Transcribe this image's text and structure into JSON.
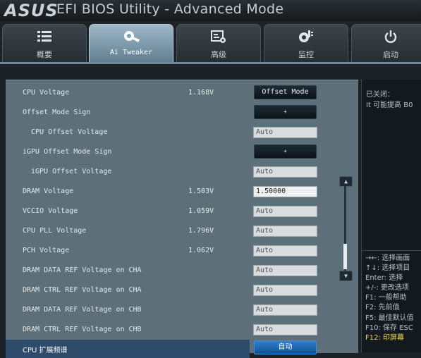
{
  "header": {
    "logo": "ASUS",
    "title": "EFI BIOS Utility - Advanced Mode"
  },
  "tabs": [
    {
      "label": "概要",
      "icon": "list-icon"
    },
    {
      "label": "Ai Tweaker",
      "icon": "ai-tweaker-icon",
      "active": true
    },
    {
      "label": "高级",
      "icon": "advanced-icon"
    },
    {
      "label": "监控",
      "icon": "monitor-icon"
    },
    {
      "label": "启动",
      "icon": "power-icon"
    }
  ],
  "rows": [
    {
      "label": "CPU Voltage",
      "value": "1.168V",
      "button": "Offset Mode"
    },
    {
      "label": "Offset Mode Sign",
      "button": "+"
    },
    {
      "label": "CPU Offset Voltage",
      "field": "Auto"
    },
    {
      "label": "iGPU Offset Mode Sign",
      "button": "+"
    },
    {
      "label": "iGPU Offset Voltage",
      "field": "Auto"
    },
    {
      "label": "DRAM Voltage",
      "value": "1.503V",
      "field": "1.50000"
    },
    {
      "label": "VCCIO Voltage",
      "value": "1.059V",
      "field": "Auto"
    },
    {
      "label": "CPU PLL Voltage",
      "value": "1.796V",
      "field": "Auto"
    },
    {
      "label": "PCH Voltage",
      "value": "1.062V",
      "field": "Auto"
    },
    {
      "label": "DRAM DATA REF Voltage on CHA",
      "field": "Auto"
    },
    {
      "label": "DRAM CTRL REF Voltage on CHA",
      "field": "Auto"
    },
    {
      "label": "DRAM DATA REF Voltage on CHB",
      "field": "Auto"
    },
    {
      "label": "DRAM CTRL REF Voltage on CHB",
      "field": "Auto"
    },
    {
      "label": "CPU 扩展频谱",
      "button": "自动"
    }
  ],
  "scroll": {
    "up": "▲",
    "down": "▼"
  },
  "help": {
    "line1": "已关闭：",
    "line2": "It 可能提高 B0"
  },
  "keys": [
    "→←: 选择画面",
    "↑↓: 选择项目",
    "Enter: 选择",
    "+/-: 更改选项",
    "F1: 一般帮助",
    "F2: 先前值",
    "F5: 最佳默认值",
    "F10: 保存  ESC",
    "F12: 印屏幕"
  ],
  "colors": {
    "panel": "#5d7079",
    "highlight_key": "#f1d84b",
    "selected_button": "#2f7fd0"
  }
}
